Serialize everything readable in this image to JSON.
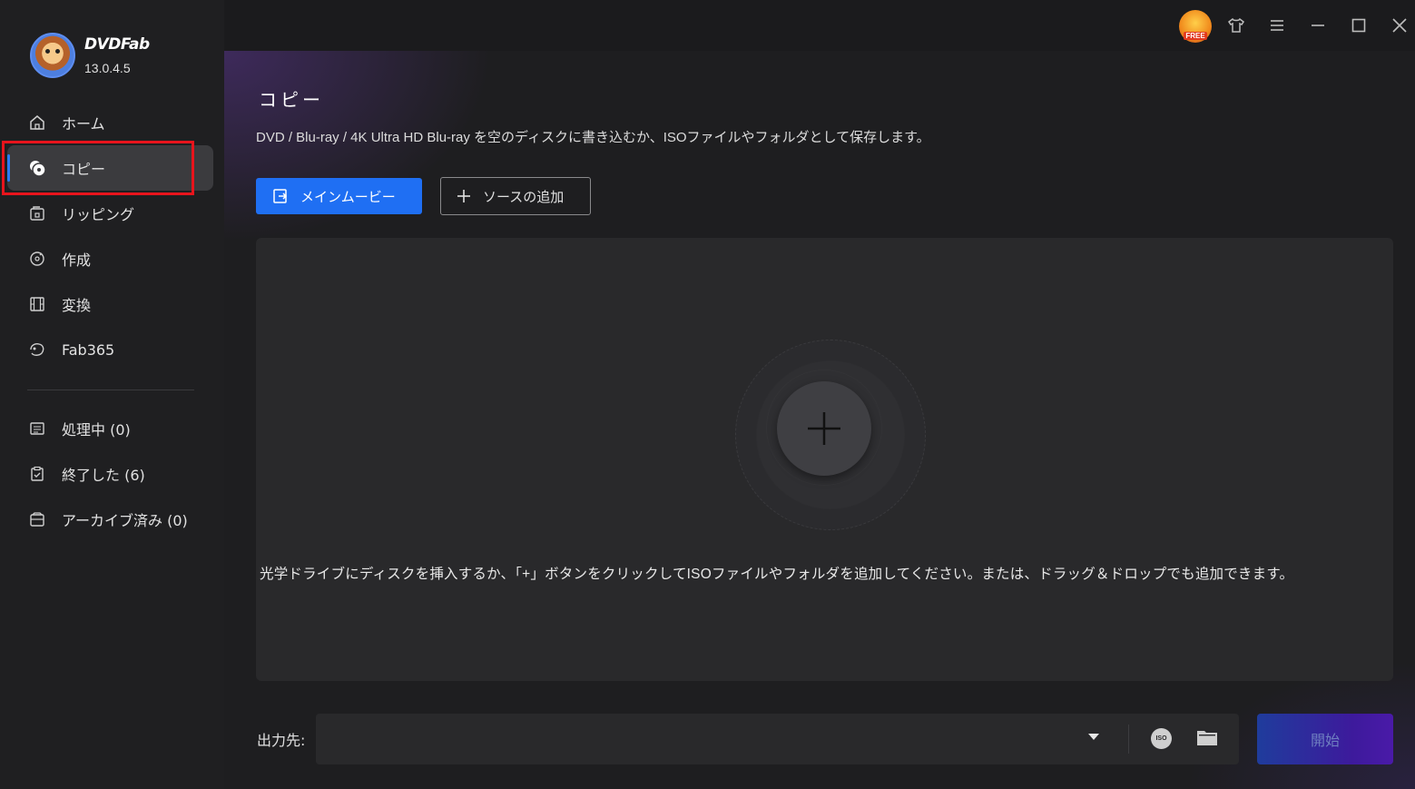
{
  "app": {
    "name": "DVDFab",
    "version": "13.0.4.5"
  },
  "sidebar": {
    "items": [
      {
        "label": "ホーム",
        "icon": "home-icon"
      },
      {
        "label": "コピー",
        "icon": "disc-copy-icon"
      },
      {
        "label": "リッピング",
        "icon": "ripper-icon"
      },
      {
        "label": "作成",
        "icon": "creator-icon"
      },
      {
        "label": "変換",
        "icon": "film-icon"
      },
      {
        "label": "Fab365",
        "icon": "fab365-icon"
      }
    ],
    "queue_items": [
      {
        "label": "処理中 (0)",
        "icon": "task-list-icon"
      },
      {
        "label": "終了した (6)",
        "icon": "clipboard-check-icon"
      },
      {
        "label": "アーカイブ済み (0)",
        "icon": "archive-icon"
      }
    ],
    "active_index": 1
  },
  "titlebar": {
    "free_badge": "FREE"
  },
  "main": {
    "title": "コピー",
    "description": "DVD / Blu-ray / 4K Ultra HD Blu-ray を空のディスクに書き込むか、ISOファイルやフォルダとして保存します。",
    "mode_button": "メインムービー",
    "add_source_button": "ソースの追加",
    "drop_hint": "光学ドライブにディスクを挿入するか、「+」ボタンをクリックしてISOファイルやフォルダを追加してください。または、ドラッグ＆ドロップでも追加できます。",
    "output_label": "出力先:",
    "output_value": "",
    "iso_label": "ISO",
    "start_button": "開始"
  },
  "colors": {
    "accent": "#1f6ff3",
    "highlight_box": "#e8141c",
    "sidebar_bg": "#1f1f21",
    "panel_bg": "#29292b"
  }
}
